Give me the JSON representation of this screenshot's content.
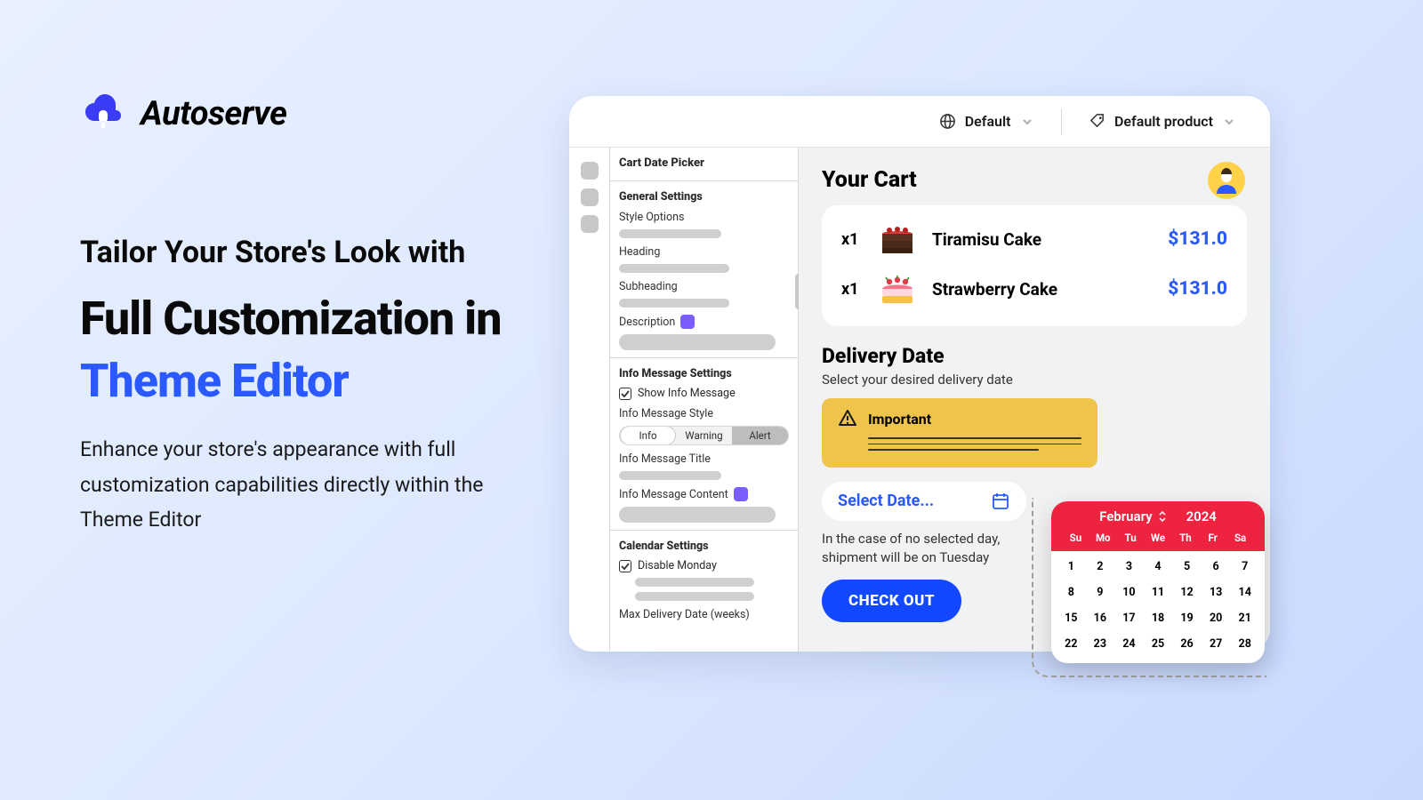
{
  "brand": {
    "name": "Autoserve"
  },
  "headline": {
    "line1": "Tailor Your Store's Look with",
    "line2_a": "Full Customization in ",
    "line2_b": "Theme Editor"
  },
  "description": "Enhance your store's appearance with full customization capabilities directly within the Theme Editor",
  "topbar": {
    "locale": "Default",
    "product": "Default product"
  },
  "settings": {
    "panel_title": "Cart Date Picker",
    "general": "General Settings",
    "style_options": "Style Options",
    "heading": "Heading",
    "subheading": "Subheading",
    "description": "Description",
    "info_group": "Info Message Settings",
    "show_info": "Show Info Message",
    "info_style": "Info Message Style",
    "seg_info": "Info",
    "seg_warning": "Warning",
    "seg_alert": "Alert",
    "info_title": "Info Message Title",
    "info_content": "Info Message Content",
    "calendar_group": "Calendar Settings",
    "disable_monday": "Disable Monday",
    "max_delivery": "Max Delivery Date (weeks)"
  },
  "cart": {
    "title": "Your Cart",
    "items": [
      {
        "qty": "x1",
        "name": "Tiramisu Cake",
        "price": "$131.0"
      },
      {
        "qty": "x1",
        "name": "Strawberry Cake",
        "price": "$131.0"
      }
    ]
  },
  "delivery": {
    "title": "Delivery Date",
    "subtitle": "Select your desired delivery date",
    "alert_label": "Important",
    "select_placeholder": "Select Date...",
    "no_date": "In the case of no selected day, shipment will be on Tuesday",
    "checkout": "CHECK OUT"
  },
  "calendar": {
    "month": "February",
    "year": "2024",
    "dow": [
      "Su",
      "Mo",
      "Tu",
      "We",
      "Th",
      "Fr",
      "Sa"
    ],
    "days": [
      "",
      "",
      "",
      "",
      "1",
      "2",
      "3",
      "4",
      "5",
      "6",
      "7",
      "8",
      "9",
      "10",
      "11",
      "12",
      "13",
      "14",
      "15",
      "16",
      "17",
      "18",
      "19",
      "20",
      "21",
      "22",
      "23",
      "24",
      "25",
      "26",
      "27",
      "28",
      "",
      "",
      ""
    ],
    "shift": true
  }
}
